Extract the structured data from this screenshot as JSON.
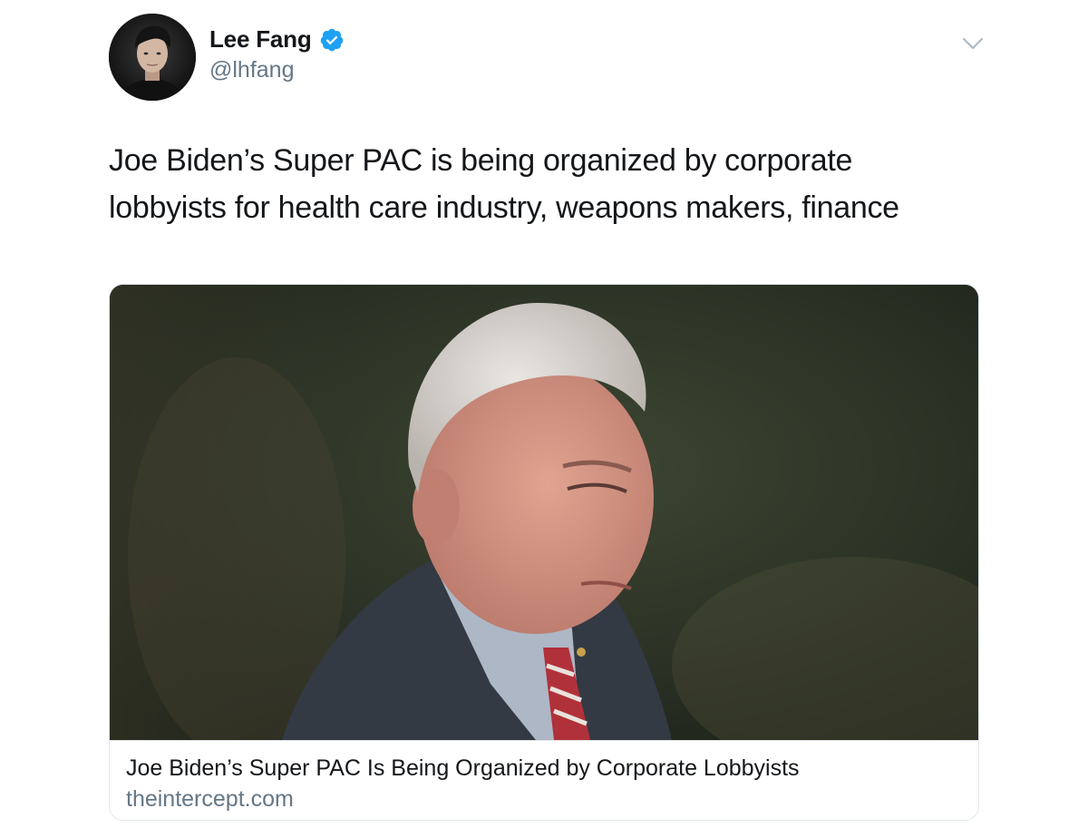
{
  "tweet": {
    "author": {
      "display_name": "Lee Fang",
      "handle": "@lhfang",
      "verified": true,
      "avatar_icon": "profile-photo"
    },
    "text_lines": [
      "Joe Biden’s Super PAC is being organized by corporate",
      "lobbyists for health care industry, weapons makers, finance"
    ],
    "menu_icon": "chevron-down-icon",
    "card": {
      "title": "Joe Biden’s Super PAC Is Being Organized by Corporate Lobbyists",
      "domain": "theintercept.com",
      "image": "photo-of-man-in-suit-and-red-striped-tie"
    }
  },
  "colors": {
    "text_primary": "#14171a",
    "text_secondary": "#657786",
    "verified_blue": "#1da1f2",
    "border": "#e1e8ed"
  }
}
